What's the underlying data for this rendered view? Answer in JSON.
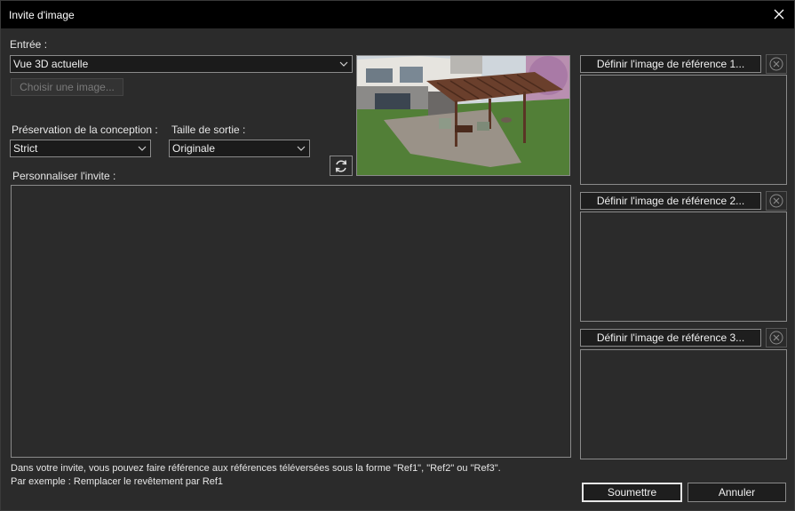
{
  "window": {
    "title": "Invite d'image"
  },
  "input": {
    "label": "Entrée :",
    "source_value": "Vue 3D actuelle",
    "choose_image_label": "Choisir une image..."
  },
  "design_preservation": {
    "label": "Préservation de la conception :",
    "value": "Strict"
  },
  "output_size": {
    "label": "Taille de sortie :",
    "value": "Originale"
  },
  "prompt": {
    "label": "Personnaliser l'invite :",
    "value": ""
  },
  "references": [
    {
      "button_label": "Définir l'image de référence 1..."
    },
    {
      "button_label": "Définir l'image de référence 2..."
    },
    {
      "button_label": "Définir l'image de référence 3..."
    }
  ],
  "hints": {
    "line1": "Dans votre invite, vous pouvez faire référence aux références téléversées sous la forme \"Ref1\", \"Ref2\" ou \"Ref3\".",
    "line2": "Par exemple : Remplacer le revêtement par Ref1"
  },
  "actions": {
    "submit_label": "Soumettre",
    "cancel_label": "Annuler"
  },
  "colors": {
    "background": "#2b2b2b",
    "titlebar": "#000000",
    "field": "#1b1b1b",
    "border": "#8a8a8a",
    "lawn": "#4f7a35"
  },
  "icons": {
    "close": "close-icon",
    "chevron": "chevron-down-icon",
    "refresh": "refresh-icon",
    "clear": "clear-circle-icon"
  }
}
